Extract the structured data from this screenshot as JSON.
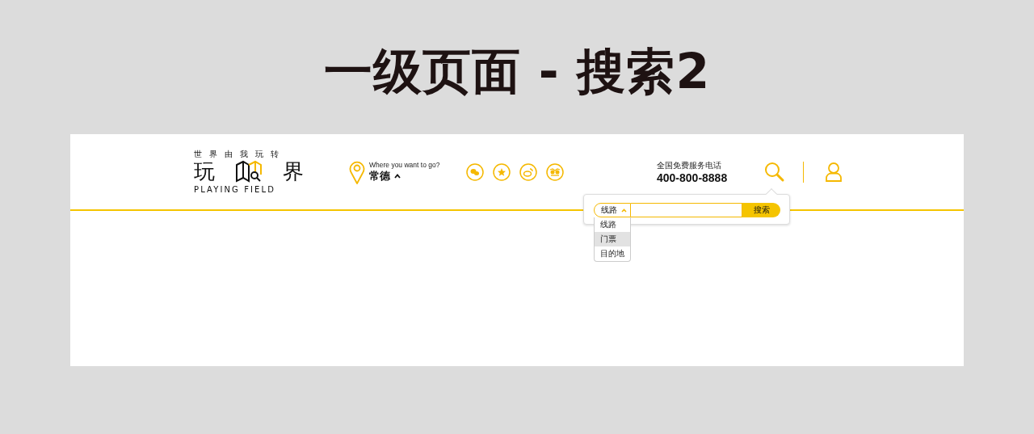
{
  "page_title": "一级页面 - 搜索2",
  "logo": {
    "tagline": "世界由我玩转",
    "name_left": "玩",
    "name_right": "界",
    "subtitle": "PLAYING FIELD"
  },
  "location": {
    "prompt": "Where you want to go?",
    "city": "常德"
  },
  "hotline": {
    "label": "全国免费服务电话",
    "number": "400-800-8888"
  },
  "search_popup": {
    "category": "线路",
    "expanded": true,
    "button": "搜索",
    "options": [
      {
        "label": "线路",
        "selected": false
      },
      {
        "label": "门票",
        "selected": true
      },
      {
        "label": "目的地",
        "selected": false
      }
    ]
  }
}
